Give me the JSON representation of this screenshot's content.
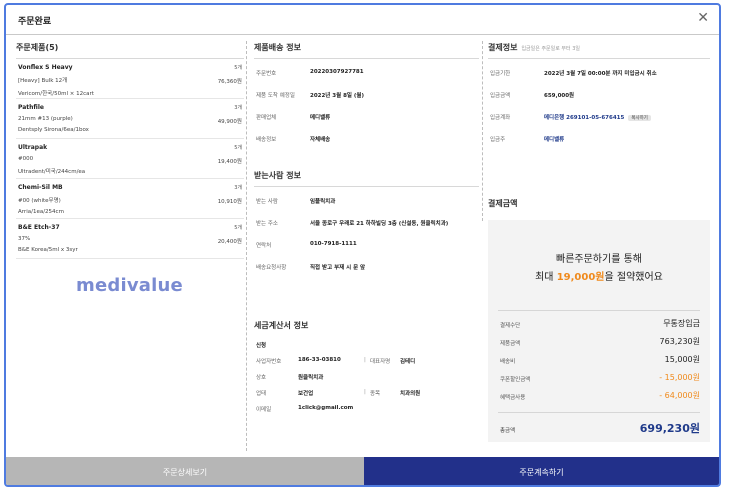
{
  "modal": {
    "title": "주문완료",
    "close_icon": "close-icon"
  },
  "products": {
    "title": "주문제품(5)",
    "items": [
      {
        "name": "Vonflex S Heavy",
        "qty": "5개",
        "option": "[Heavy] Bulk 12개",
        "price": "76,360원",
        "maker": "Vericom/한국/50ml × 12cart"
      },
      {
        "name": "Pathfile",
        "qty": "3개",
        "option": "21mm #13 (purple)",
        "price": "49,900원",
        "maker": "Dentsply Sirona/6ea/1box"
      },
      {
        "name": "Ultrapak",
        "qty": "5개",
        "option": "#000",
        "price": "19,400원",
        "maker": "Ultradent/미국/244cm/ea"
      },
      {
        "name": "Chemi-Sil MB",
        "qty": "3개",
        "option": "#00 (white무명)",
        "price": "10,910원",
        "maker": "Arria/1ea/254cm"
      },
      {
        "name": "B&E Etch-37",
        "qty": "5개",
        "option": "37%",
        "price": "20,400원",
        "maker": "B&E Korea/5ml x 3syr"
      }
    ],
    "logo": "medivalue"
  },
  "delivery": {
    "title": "제품배송 정보",
    "rows": [
      {
        "k": "주문번호",
        "v": "20220307927781"
      },
      {
        "k": "제품 도착 예정일",
        "v": "2022년 3월 8일 (월)"
      },
      {
        "k": "판매업체",
        "v": "메디밸류"
      },
      {
        "k": "배송정보",
        "v": "자체배송"
      }
    ]
  },
  "receiver": {
    "title": "받는사람 정보",
    "rows": [
      {
        "k": "받는 사람",
        "v": "임플릭치과"
      },
      {
        "k": "받는 주소",
        "v": "서울 종로구 우래로 21 하하빌딩 3층 (신설동, 원클릭치과)"
      },
      {
        "k": "연락처",
        "v": "010-7918-1111"
      },
      {
        "k": "배송요청사항",
        "v": "직접 받고 부재 시 문 앞"
      }
    ]
  },
  "tax": {
    "title": "세금계산서 정보",
    "status": "신청",
    "biz_no_label": "사업자번호",
    "biz_no": "186-33-03810",
    "ceo_label": "대표자명",
    "ceo": "김테디",
    "company_label": "상호",
    "company": "원클릭치과",
    "type_label": "업태",
    "type": "보건업",
    "item_label": "종목",
    "item": "치과의원",
    "email_label": "이메일",
    "email": "1click@gmail.com"
  },
  "payinfo": {
    "title": "결제정보",
    "subtitle": "입금일은 주문일로 부터 3일",
    "rows": [
      {
        "k": "입금기한",
        "v": "2022년 3월 7일 00:00분 까지 미입금시 취소"
      },
      {
        "k": "입금금액",
        "v": "659,000원"
      },
      {
        "k": "입금계좌",
        "v": "메디은행 269101-05-676415",
        "tag": "복사하기"
      },
      {
        "k": "입금주",
        "v": "메디밸류"
      }
    ]
  },
  "payment": {
    "title": "결제금액",
    "promo_line1": "빠른주문하기를 통해",
    "promo_prefix": "최대 ",
    "promo_amount": "19,000원",
    "promo_suffix": "을 절약했어요",
    "rows": [
      {
        "k": "결제수단",
        "v": "무통장입금"
      },
      {
        "k": "제품금액",
        "v": "763,230원"
      },
      {
        "k": "배송비",
        "v": "15,000원"
      },
      {
        "k": "쿠폰할인금액",
        "v": "- 15,000원"
      },
      {
        "k": "혜택금사용",
        "v": "- 64,000원"
      }
    ],
    "total_label": "총금액",
    "total_value": "699,230원",
    "accent_blue": "#1f3a8a",
    "accent_orange": "#f08a1c"
  },
  "footer": {
    "detail_button": "주문상세보기",
    "continue_button": "주문계속하기"
  }
}
